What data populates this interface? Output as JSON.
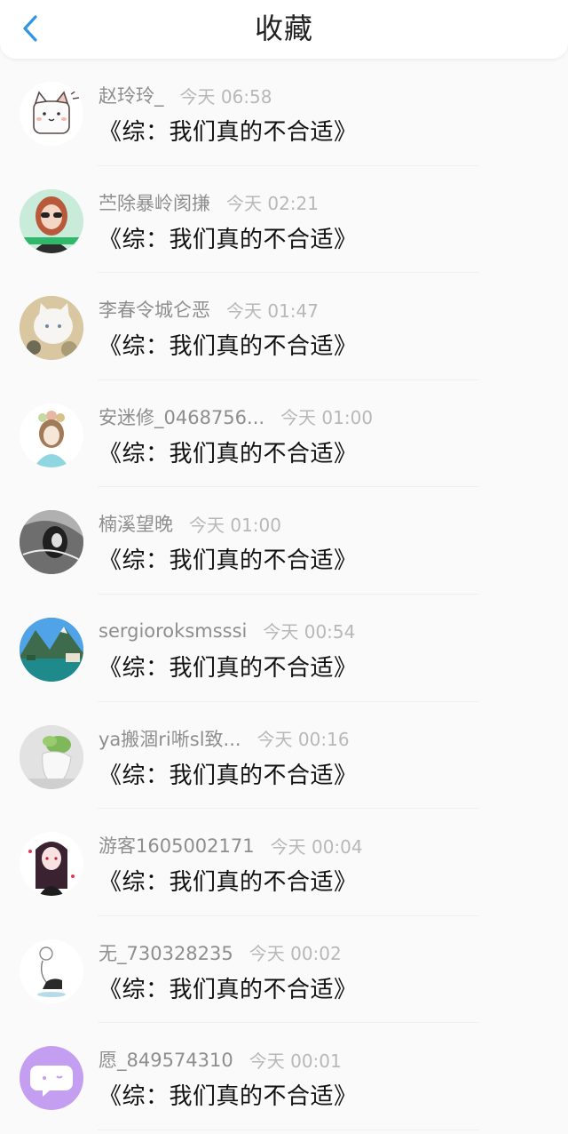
{
  "header": {
    "title": "收藏",
    "back_icon": "chevron-left-icon",
    "accent_color": "#2f95e8"
  },
  "items": [
    {
      "name": "赵玲玲_",
      "time": "今天 06:58",
      "content": "《综：我们真的不合适》",
      "avatar": "cat-cartoon-avatar"
    },
    {
      "name": "苎除暴岭阂搛",
      "time": "今天 02:21",
      "content": "《综：我们真的不合适》",
      "avatar": "girl-sunglasses-photo-avatar"
    },
    {
      "name": "李春令城仑恶",
      "time": "今天 01:47",
      "content": "《综：我们真的不合适》",
      "avatar": "white-cat-photo-avatar"
    },
    {
      "name": "安迷修_0468756...",
      "time": "今天 01:00",
      "content": "《综：我们真的不合适》",
      "avatar": "anime-flower-girl-avatar"
    },
    {
      "name": "楠溪望晚",
      "time": "今天 01:00",
      "content": "《综：我们真的不合适》",
      "avatar": "gray-anime-figure-avatar"
    },
    {
      "name": "sergioroksmsssi",
      "time": "今天 00:54",
      "content": "《综：我们真的不合适》",
      "avatar": "lake-mountain-photo-avatar"
    },
    {
      "name": "ya搬涸ri唽sl致...",
      "time": "今天 00:16",
      "content": "《综：我们真的不合适》",
      "avatar": "plant-vase-photo-avatar"
    },
    {
      "name": "游客1605002171",
      "time": "今天 00:04",
      "content": "《综：我们真的不合适》",
      "avatar": "anime-dark-hair-girl-avatar"
    },
    {
      "name": "无_730328235",
      "time": "今天 00:02",
      "content": "《综：我们真的不合适》",
      "avatar": "sketch-sitting-figure-avatar"
    },
    {
      "name": "愿_849574310",
      "time": "今天 00:01",
      "content": "《综：我们真的不合适》",
      "avatar": "purple-chat-bubble-avatar"
    }
  ]
}
